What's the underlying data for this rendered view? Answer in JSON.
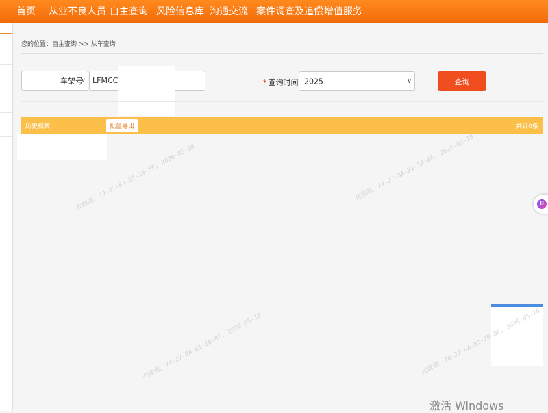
{
  "nav": {
    "items": [
      "首页",
      "从业不良人员",
      "自主查询",
      "风险信息库",
      "沟通交流",
      "案件调查及追偿",
      "增值服务"
    ]
  },
  "breadcrumb": {
    "text": "您的位置：自主查询 >> 从车查询"
  },
  "search": {
    "field_type_value": "车架号",
    "vin_value": "LFMCC1E",
    "time_label": "查询时间:",
    "required_mark": "*",
    "time_value": "2025",
    "query_button": "查询"
  },
  "results": {
    "title": "历史档案",
    "export_button": "批量导出",
    "count_text": "共计0条"
  },
  "watermark_text": "代商测, 74-27-8A-B1-1B-0F, 2026-05-18",
  "os_overlay": "激活 Windows",
  "colors": {
    "nav_orange": "#f26a0a",
    "query_button": "#f04e1f",
    "results_bar": "#fbbf4a"
  }
}
